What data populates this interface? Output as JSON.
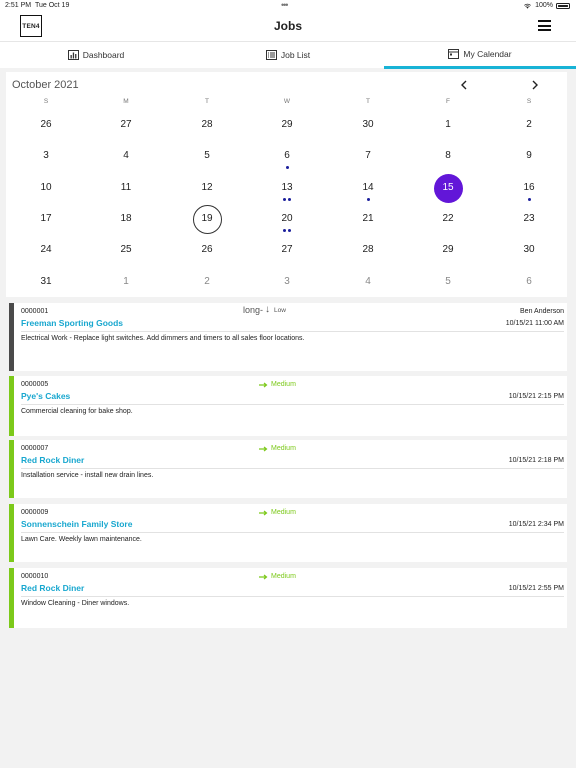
{
  "status_bar": {
    "time": "2:51 PM",
    "date": "Tue Oct 19",
    "battery": "100%"
  },
  "header": {
    "logo": "TEN4",
    "title": "Jobs"
  },
  "tabs": [
    {
      "label": "Dashboard",
      "icon": "chart-icon",
      "active": false
    },
    {
      "label": "Job List",
      "icon": "list-icon",
      "active": false
    },
    {
      "label": "My Calendar",
      "icon": "calendar-icon",
      "active": true
    }
  ],
  "calendar": {
    "month": "October 2021",
    "weekdays": [
      "S",
      "M",
      "T",
      "W",
      "T",
      "F",
      "S"
    ],
    "weeks": [
      [
        {
          "d": "26",
          "muted": false
        },
        {
          "d": "27",
          "muted": false
        },
        {
          "d": "28",
          "muted": false
        },
        {
          "d": "29",
          "muted": false
        },
        {
          "d": "30",
          "muted": false
        },
        {
          "d": "1"
        },
        {
          "d": "2"
        }
      ],
      [
        {
          "d": "3"
        },
        {
          "d": "4"
        },
        {
          "d": "5"
        },
        {
          "d": "6",
          "dots": 1
        },
        {
          "d": "7"
        },
        {
          "d": "8"
        },
        {
          "d": "9"
        }
      ],
      [
        {
          "d": "10"
        },
        {
          "d": "11"
        },
        {
          "d": "12"
        },
        {
          "d": "13",
          "dots": 2
        },
        {
          "d": "14",
          "dots": 1
        },
        {
          "d": "15",
          "selected": true
        },
        {
          "d": "16",
          "dots": 1
        }
      ],
      [
        {
          "d": "17"
        },
        {
          "d": "18"
        },
        {
          "d": "19",
          "today": true
        },
        {
          "d": "20",
          "dots": 2
        },
        {
          "d": "21"
        },
        {
          "d": "22"
        },
        {
          "d": "23"
        }
      ],
      [
        {
          "d": "24"
        },
        {
          "d": "25"
        },
        {
          "d": "26"
        },
        {
          "d": "27"
        },
        {
          "d": "28"
        },
        {
          "d": "29"
        },
        {
          "d": "30"
        }
      ],
      [
        {
          "d": "31"
        },
        {
          "d": "1",
          "muted": true
        },
        {
          "d": "2",
          "muted": true
        },
        {
          "d": "3",
          "muted": true
        },
        {
          "d": "4",
          "muted": true
        },
        {
          "d": "5",
          "muted": true
        },
        {
          "d": "6",
          "muted": true
        }
      ]
    ],
    "selected_color": "#6216d8",
    "dot_color": "#1b1f9c"
  },
  "jobs": [
    {
      "id": "0000001",
      "priority_label": "long-",
      "priority": "Low",
      "assignee": "Ben Anderson",
      "customer": "Freeman Sporting Goods",
      "datetime": "10/15/21 11:00 AM",
      "description": "Electrical Work - Replace light switches. Add dimmers and timers to all sales floor locations.",
      "stripe_color": "#4a4a4a"
    },
    {
      "id": "0000005",
      "priority": "Medium",
      "assignee": "",
      "customer": "Pye's Cakes",
      "datetime": "10/15/21  2:15 PM",
      "description": "Commercial cleaning for bake shop.",
      "stripe_color": "#7cc91a"
    },
    {
      "id": "0000007",
      "priority": "Medium",
      "assignee": "",
      "customer": "Red Rock Diner",
      "datetime": "10/15/21  2:18 PM",
      "description": "Installation service - install new drain lines.",
      "stripe_color": "#7cc91a"
    },
    {
      "id": "0000009",
      "priority": "Medium",
      "assignee": "",
      "customer": "Sonnenschein Family Store",
      "datetime": "10/15/21  2:34 PM",
      "description": "Lawn Care. Weekly lawn maintenance.",
      "stripe_color": "#7cc91a"
    },
    {
      "id": "0000010",
      "priority": "Medium",
      "assignee": "",
      "customer": "Red Rock Diner",
      "datetime": "10/15/21  2:55 PM",
      "description": "Window Cleaning - Diner windows.",
      "stripe_color": "#7cc91a"
    }
  ]
}
